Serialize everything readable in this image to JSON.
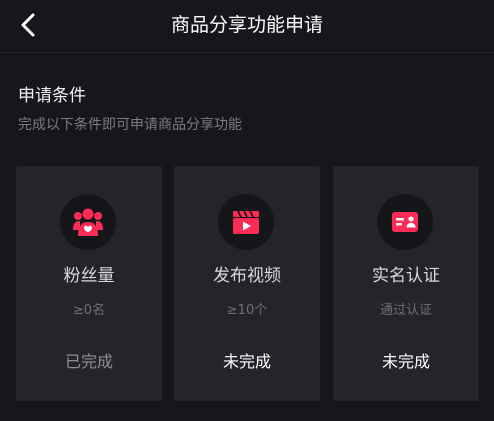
{
  "header": {
    "title": "商品分享功能申请",
    "back_icon": "chevron-left-icon"
  },
  "section": {
    "title": "申请条件",
    "subtitle": "完成以下条件即可申请商品分享功能"
  },
  "colors": {
    "accent": "#fe2c55",
    "background": "#16171c",
    "card": "#24252b"
  },
  "conditions": [
    {
      "icon": "followers-icon",
      "label": "粉丝量",
      "requirement": "≥0名",
      "status": "已完成"
    },
    {
      "icon": "video-icon",
      "label": "发布视频",
      "requirement": "≥10个",
      "status": "未完成"
    },
    {
      "icon": "id-card-icon",
      "label": "实名认证",
      "requirement": "通过认证",
      "status": "未完成"
    }
  ]
}
